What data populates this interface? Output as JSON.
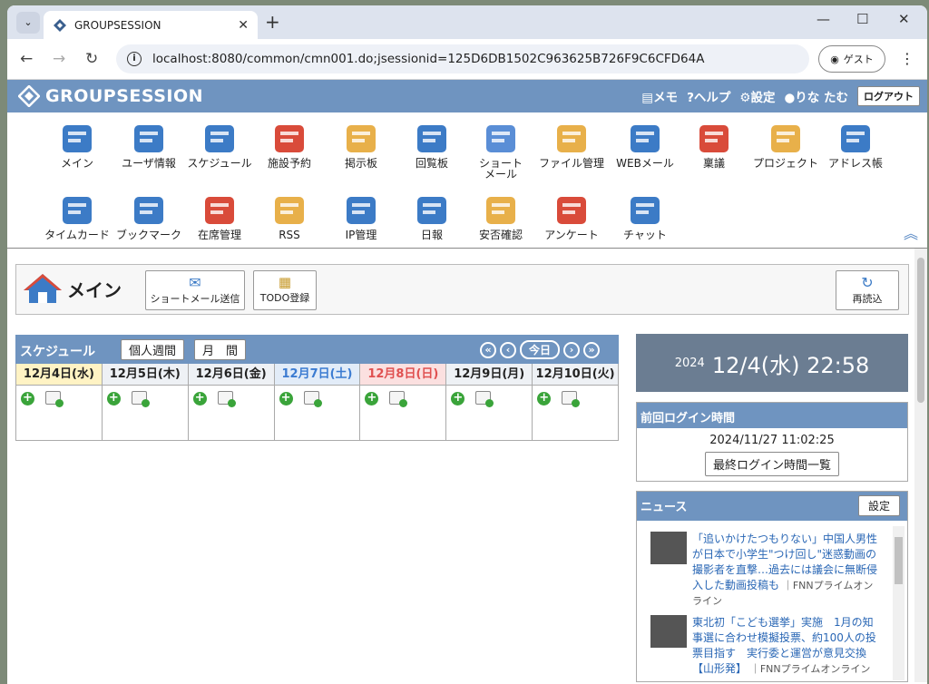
{
  "browser": {
    "tab_title": "GROUPSESSION",
    "url": "localhost:8080/common/cmn001.do;jsessionid=125D6DB1502C963625B726F9C6CFD64A",
    "guest": "ゲスト"
  },
  "header": {
    "logo": "GROUPSESSION",
    "memo": "メモ",
    "help": "ヘルプ",
    "settings": "設定",
    "user": "りな たむ",
    "logout": "ログアウト"
  },
  "apps": [
    {
      "label": "メイン",
      "icon": "home-icon"
    },
    {
      "label": "ユーザ情報",
      "icon": "user-info-icon"
    },
    {
      "label": "スケジュール",
      "icon": "calendar-icon"
    },
    {
      "label": "施設予約",
      "icon": "facility-icon"
    },
    {
      "label": "掲示板",
      "icon": "board-icon"
    },
    {
      "label": "回覧板",
      "icon": "circular-icon"
    },
    {
      "label": "ショート\nメール",
      "icon": "mail-icon"
    },
    {
      "label": "ファイル管理",
      "icon": "folder-icon"
    },
    {
      "label": "WEBメール",
      "icon": "webmail-icon"
    },
    {
      "label": "稟議",
      "icon": "approval-icon"
    },
    {
      "label": "プロジェクト",
      "icon": "project-icon"
    },
    {
      "label": "アドレス帳",
      "icon": "address-icon"
    },
    {
      "label": "タイムカード",
      "icon": "timecard-icon"
    },
    {
      "label": "ブックマーク",
      "icon": "bookmark-icon"
    },
    {
      "label": "在席管理",
      "icon": "presence-icon"
    },
    {
      "label": "RSS",
      "icon": "rss-icon"
    },
    {
      "label": "IP管理",
      "icon": "ip-icon"
    },
    {
      "label": "日報",
      "icon": "report-icon"
    },
    {
      "label": "安否確認",
      "icon": "safety-icon"
    },
    {
      "label": "アンケート",
      "icon": "survey-icon"
    },
    {
      "label": "チャット",
      "icon": "chat-icon"
    }
  ],
  "main": {
    "title": "メイン",
    "shortmail_btn": "ショートメール送信",
    "todo_btn": "TODO登録",
    "reload_btn": "再読込"
  },
  "schedule": {
    "label": "スケジュール",
    "personal_week": "個人週間",
    "month": "月　間",
    "today": "今日",
    "days": [
      {
        "label": "12月4日(水)",
        "kind": "today"
      },
      {
        "label": "12月5日(木)",
        "kind": "normal"
      },
      {
        "label": "12月6日(金)",
        "kind": "normal"
      },
      {
        "label": "12月7日(土)",
        "kind": "sat"
      },
      {
        "label": "12月8日(日)",
        "kind": "sun"
      },
      {
        "label": "12月9日(月)",
        "kind": "normal"
      },
      {
        "label": "12月10日(火)",
        "kind": "normal"
      }
    ]
  },
  "clock": {
    "year": "2024",
    "datetime": "12/4(水) 22:58"
  },
  "last_login": {
    "title": "前回ログイン時間",
    "value": "2024/11/27 11:02:25",
    "button": "最終ログイン時間一覧"
  },
  "news": {
    "title": "ニュース",
    "settings": "設定",
    "items": [
      {
        "text": "「追いかけたつもりない」中国人男性が日本で小学生\"つけ回し\"迷惑動画の撮影者を直撃…過去には議会に無断侵入した動画投稿も",
        "source": "FNNプライムオンライン"
      },
      {
        "text": "東北初「こども選挙」実施　1月の知事選に合わせ模擬投票、約100人の投票目指す　実行委と運営が意見交換【山形発】",
        "source": "FNNプライムオンライン"
      }
    ]
  }
}
